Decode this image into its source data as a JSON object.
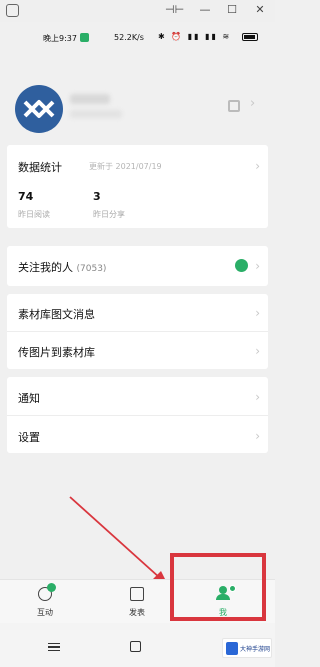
{
  "status_bar": {
    "time": "晚上9:37",
    "net_speed": "52.2K/s",
    "status_icons": "✱ ⏰ ▮▮ ▮▮ ≋"
  },
  "window_controls": {
    "snap": "⊣⊢",
    "minimize": "—",
    "maximize": "☐",
    "close": "✕"
  },
  "stats": {
    "title": "数据统计",
    "date": "更新于 2021/07/19",
    "items": [
      {
        "value": "74",
        "label": "昨日阅读"
      },
      {
        "value": "3",
        "label": "昨日分享"
      }
    ]
  },
  "followers": {
    "label": "关注我的人",
    "count": "(7053)"
  },
  "menu": {
    "material_news": "素材库图文消息",
    "upload_images": "传图片到素材库",
    "notifications": "通知",
    "settings": "设置"
  },
  "tabbar": {
    "tabs": [
      {
        "label": "互动"
      },
      {
        "label": "发表"
      },
      {
        "label": "我"
      }
    ]
  },
  "watermark": "大神手游网",
  "chevron": "›",
  "colors": {
    "accent_green": "#2aae67",
    "highlight_red": "#d9363e",
    "avatar_blue": "#2f5f9e"
  }
}
